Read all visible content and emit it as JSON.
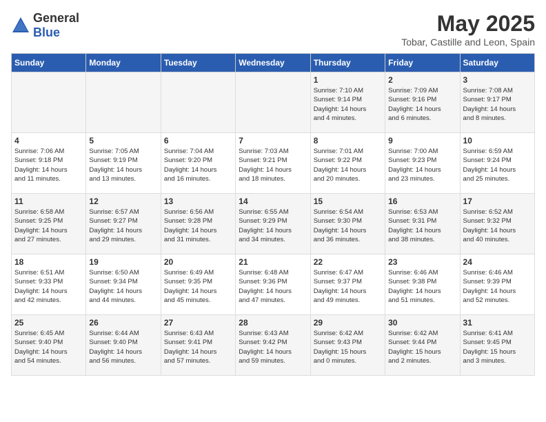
{
  "logo": {
    "general": "General",
    "blue": "Blue"
  },
  "title": "May 2025",
  "subtitle": "Tobar, Castille and Leon, Spain",
  "days_header": [
    "Sunday",
    "Monday",
    "Tuesday",
    "Wednesday",
    "Thursday",
    "Friday",
    "Saturday"
  ],
  "weeks": [
    [
      {
        "day": "",
        "info": ""
      },
      {
        "day": "",
        "info": ""
      },
      {
        "day": "",
        "info": ""
      },
      {
        "day": "",
        "info": ""
      },
      {
        "day": "1",
        "info": "Sunrise: 7:10 AM\nSunset: 9:14 PM\nDaylight: 14 hours\nand 4 minutes."
      },
      {
        "day": "2",
        "info": "Sunrise: 7:09 AM\nSunset: 9:16 PM\nDaylight: 14 hours\nand 6 minutes."
      },
      {
        "day": "3",
        "info": "Sunrise: 7:08 AM\nSunset: 9:17 PM\nDaylight: 14 hours\nand 8 minutes."
      }
    ],
    [
      {
        "day": "4",
        "info": "Sunrise: 7:06 AM\nSunset: 9:18 PM\nDaylight: 14 hours\nand 11 minutes."
      },
      {
        "day": "5",
        "info": "Sunrise: 7:05 AM\nSunset: 9:19 PM\nDaylight: 14 hours\nand 13 minutes."
      },
      {
        "day": "6",
        "info": "Sunrise: 7:04 AM\nSunset: 9:20 PM\nDaylight: 14 hours\nand 16 minutes."
      },
      {
        "day": "7",
        "info": "Sunrise: 7:03 AM\nSunset: 9:21 PM\nDaylight: 14 hours\nand 18 minutes."
      },
      {
        "day": "8",
        "info": "Sunrise: 7:01 AM\nSunset: 9:22 PM\nDaylight: 14 hours\nand 20 minutes."
      },
      {
        "day": "9",
        "info": "Sunrise: 7:00 AM\nSunset: 9:23 PM\nDaylight: 14 hours\nand 23 minutes."
      },
      {
        "day": "10",
        "info": "Sunrise: 6:59 AM\nSunset: 9:24 PM\nDaylight: 14 hours\nand 25 minutes."
      }
    ],
    [
      {
        "day": "11",
        "info": "Sunrise: 6:58 AM\nSunset: 9:25 PM\nDaylight: 14 hours\nand 27 minutes."
      },
      {
        "day": "12",
        "info": "Sunrise: 6:57 AM\nSunset: 9:27 PM\nDaylight: 14 hours\nand 29 minutes."
      },
      {
        "day": "13",
        "info": "Sunrise: 6:56 AM\nSunset: 9:28 PM\nDaylight: 14 hours\nand 31 minutes."
      },
      {
        "day": "14",
        "info": "Sunrise: 6:55 AM\nSunset: 9:29 PM\nDaylight: 14 hours\nand 34 minutes."
      },
      {
        "day": "15",
        "info": "Sunrise: 6:54 AM\nSunset: 9:30 PM\nDaylight: 14 hours\nand 36 minutes."
      },
      {
        "day": "16",
        "info": "Sunrise: 6:53 AM\nSunset: 9:31 PM\nDaylight: 14 hours\nand 38 minutes."
      },
      {
        "day": "17",
        "info": "Sunrise: 6:52 AM\nSunset: 9:32 PM\nDaylight: 14 hours\nand 40 minutes."
      }
    ],
    [
      {
        "day": "18",
        "info": "Sunrise: 6:51 AM\nSunset: 9:33 PM\nDaylight: 14 hours\nand 42 minutes."
      },
      {
        "day": "19",
        "info": "Sunrise: 6:50 AM\nSunset: 9:34 PM\nDaylight: 14 hours\nand 44 minutes."
      },
      {
        "day": "20",
        "info": "Sunrise: 6:49 AM\nSunset: 9:35 PM\nDaylight: 14 hours\nand 45 minutes."
      },
      {
        "day": "21",
        "info": "Sunrise: 6:48 AM\nSunset: 9:36 PM\nDaylight: 14 hours\nand 47 minutes."
      },
      {
        "day": "22",
        "info": "Sunrise: 6:47 AM\nSunset: 9:37 PM\nDaylight: 14 hours\nand 49 minutes."
      },
      {
        "day": "23",
        "info": "Sunrise: 6:46 AM\nSunset: 9:38 PM\nDaylight: 14 hours\nand 51 minutes."
      },
      {
        "day": "24",
        "info": "Sunrise: 6:46 AM\nSunset: 9:39 PM\nDaylight: 14 hours\nand 52 minutes."
      }
    ],
    [
      {
        "day": "25",
        "info": "Sunrise: 6:45 AM\nSunset: 9:40 PM\nDaylight: 14 hours\nand 54 minutes."
      },
      {
        "day": "26",
        "info": "Sunrise: 6:44 AM\nSunset: 9:40 PM\nDaylight: 14 hours\nand 56 minutes."
      },
      {
        "day": "27",
        "info": "Sunrise: 6:43 AM\nSunset: 9:41 PM\nDaylight: 14 hours\nand 57 minutes."
      },
      {
        "day": "28",
        "info": "Sunrise: 6:43 AM\nSunset: 9:42 PM\nDaylight: 14 hours\nand 59 minutes."
      },
      {
        "day": "29",
        "info": "Sunrise: 6:42 AM\nSunset: 9:43 PM\nDaylight: 15 hours\nand 0 minutes."
      },
      {
        "day": "30",
        "info": "Sunrise: 6:42 AM\nSunset: 9:44 PM\nDaylight: 15 hours\nand 2 minutes."
      },
      {
        "day": "31",
        "info": "Sunrise: 6:41 AM\nSunset: 9:45 PM\nDaylight: 15 hours\nand 3 minutes."
      }
    ]
  ]
}
